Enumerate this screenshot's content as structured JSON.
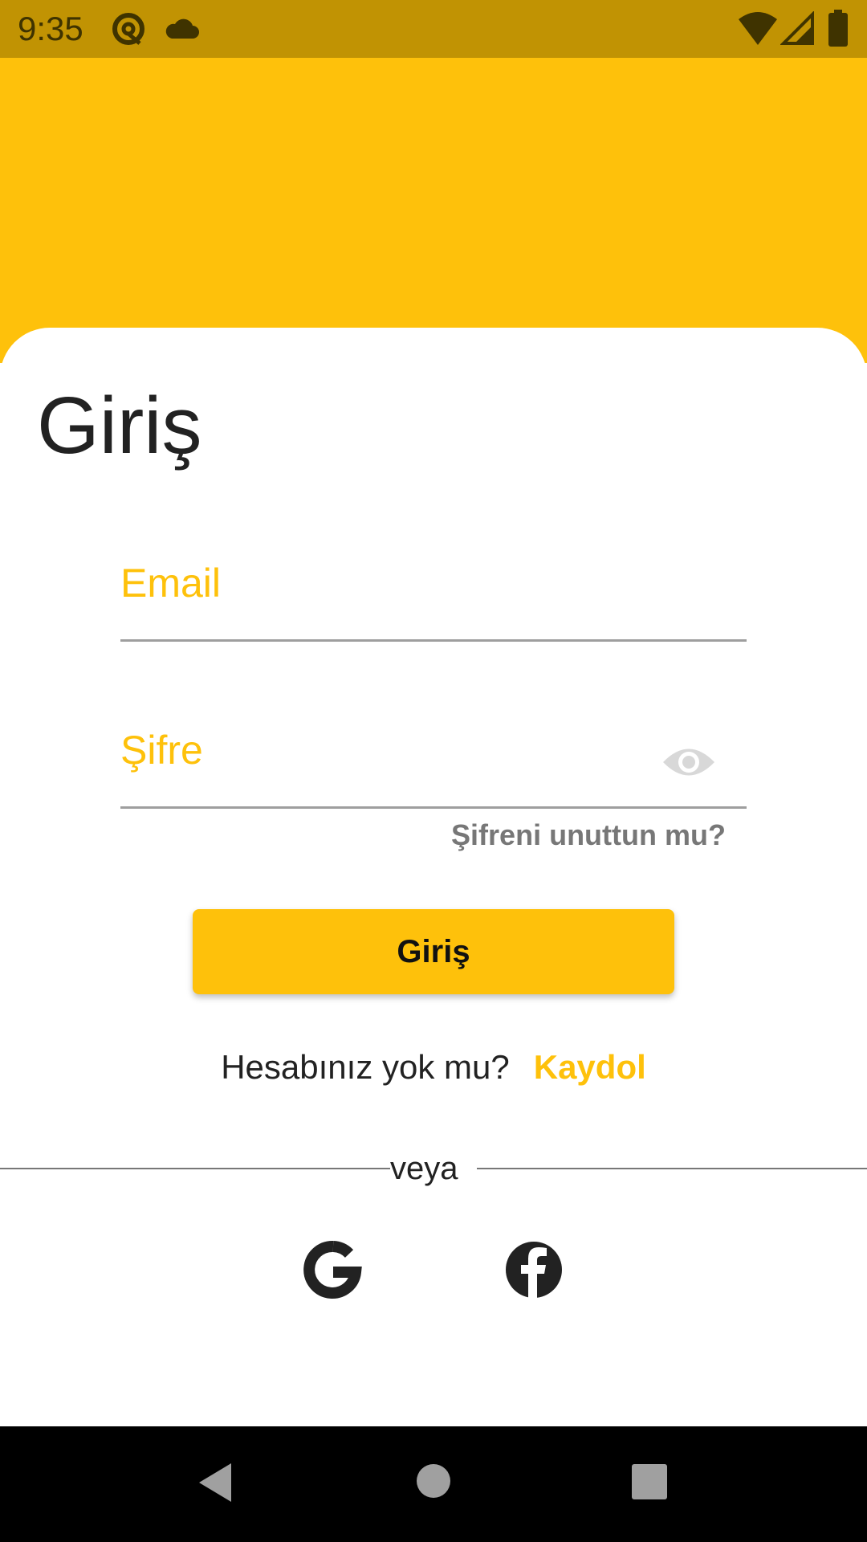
{
  "status_bar": {
    "time": "9:35",
    "icons": [
      "at-sign-icon",
      "cloud-icon",
      "wifi-icon",
      "signal-icon",
      "battery-icon"
    ]
  },
  "login": {
    "title": "Giriş",
    "email_label": "Email",
    "password_label": "Şifre",
    "forgot_password": "Şifreni unuttun mu?",
    "submit_label": "Giriş",
    "signup_prompt": "Hesabınız yok mu?",
    "signup_link": "Kaydol",
    "divider_text": "veya"
  },
  "social": [
    "google-icon",
    "facebook-icon"
  ],
  "nav_bar": [
    "back-icon",
    "home-icon",
    "recents-icon"
  ],
  "colors": {
    "accent": "#fec10b",
    "status_bar": "#c19303",
    "text_dark": "#222222",
    "text_muted": "#777777"
  }
}
